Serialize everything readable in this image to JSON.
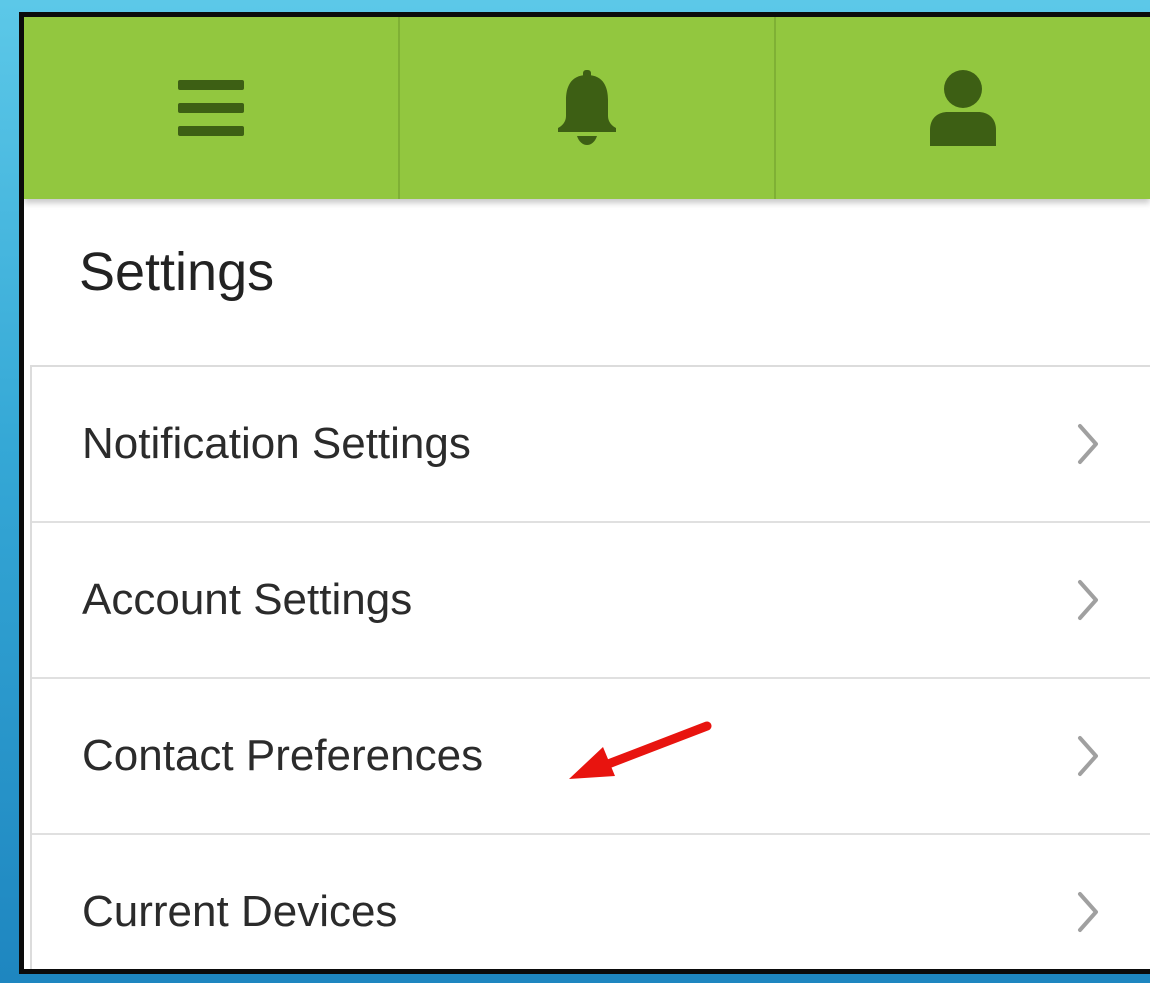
{
  "topbar": {
    "background": "#92c73f",
    "icon_color": "#3d5f14",
    "tabs": [
      {
        "icon": "hamburger-menu-icon"
      },
      {
        "icon": "bell-icon"
      },
      {
        "icon": "user-profile-icon"
      }
    ]
  },
  "page": {
    "title": "Settings"
  },
  "settings": {
    "items": [
      {
        "label": "Notification Settings",
        "icon": "chevron-right-icon"
      },
      {
        "label": "Account Settings",
        "icon": "chevron-right-icon"
      },
      {
        "label": "Contact Preferences",
        "icon": "chevron-right-icon"
      },
      {
        "label": "Current Devices",
        "icon": "chevron-right-icon"
      }
    ]
  },
  "annotation": {
    "icon": "red-arrow-icon",
    "color": "#e8140f",
    "points_to": "Contact Preferences"
  }
}
